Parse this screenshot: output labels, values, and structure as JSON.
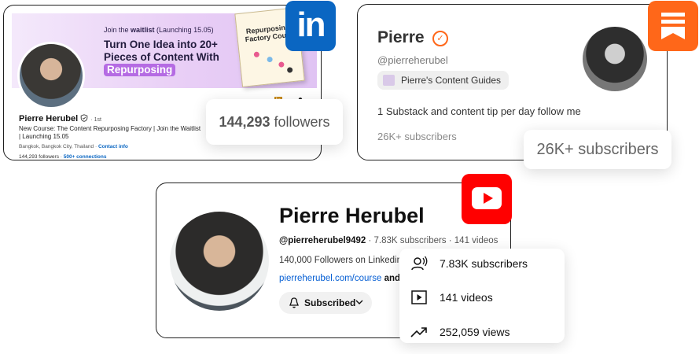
{
  "linkedin": {
    "banner": {
      "waitlist_prefix": "Join the ",
      "waitlist_bold": "waitlist",
      "waitlist_suffix": " (Launching 15.05)",
      "headline_main": "Turn One Idea into 20+ Pieces of Content With ",
      "headline_pill": "Repurposing",
      "book_title": "Repurposing Factory Cou..."
    },
    "name": "Pierre Herubel",
    "degree": "· 1st",
    "headline": "New Course: The Content Repurposing Factory | Join the Waitlist | Launching 15.05",
    "location": "Bangkok, Bangkok City, Thailand · ",
    "contact_info": "Contact info",
    "followers_small": "144,293 followers · ",
    "connections": "500+ connections",
    "mini_icon_1": "in",
    "mini_icon_2": "bell",
    "logo_text": "in",
    "popup_number": "144,293",
    "popup_label": " followers",
    "brand_color": "#0a66c2"
  },
  "substack": {
    "name": "Pierre",
    "handle": "@pierreherubel",
    "guide_label": "Pierre's Content Guides",
    "bio": "1 Substack and content tip per day follow me",
    "subscribers": "26K+ subscribers",
    "popup_subscribers": "26K+ subscribers",
    "brand_color": "#ff6719"
  },
  "youtube": {
    "name": "Pierre Herubel",
    "handle": "@pierreherubel9492",
    "meta_rest": " · 7.83K subscribers · 141 videos",
    "followers_text": "140,000 Followers on Linkedin ...",
    "link_text": "pierreherubel.com/course",
    "link_suffix": " and",
    "subscribe_label": "Subscribed",
    "stats": [
      {
        "icon": "subscribers-icon",
        "label": "7.83K subscribers"
      },
      {
        "icon": "videos-icon",
        "label": "141 videos"
      },
      {
        "icon": "views-trend-icon",
        "label": "252,059 views"
      }
    ],
    "brand_color": "#ff0000"
  }
}
